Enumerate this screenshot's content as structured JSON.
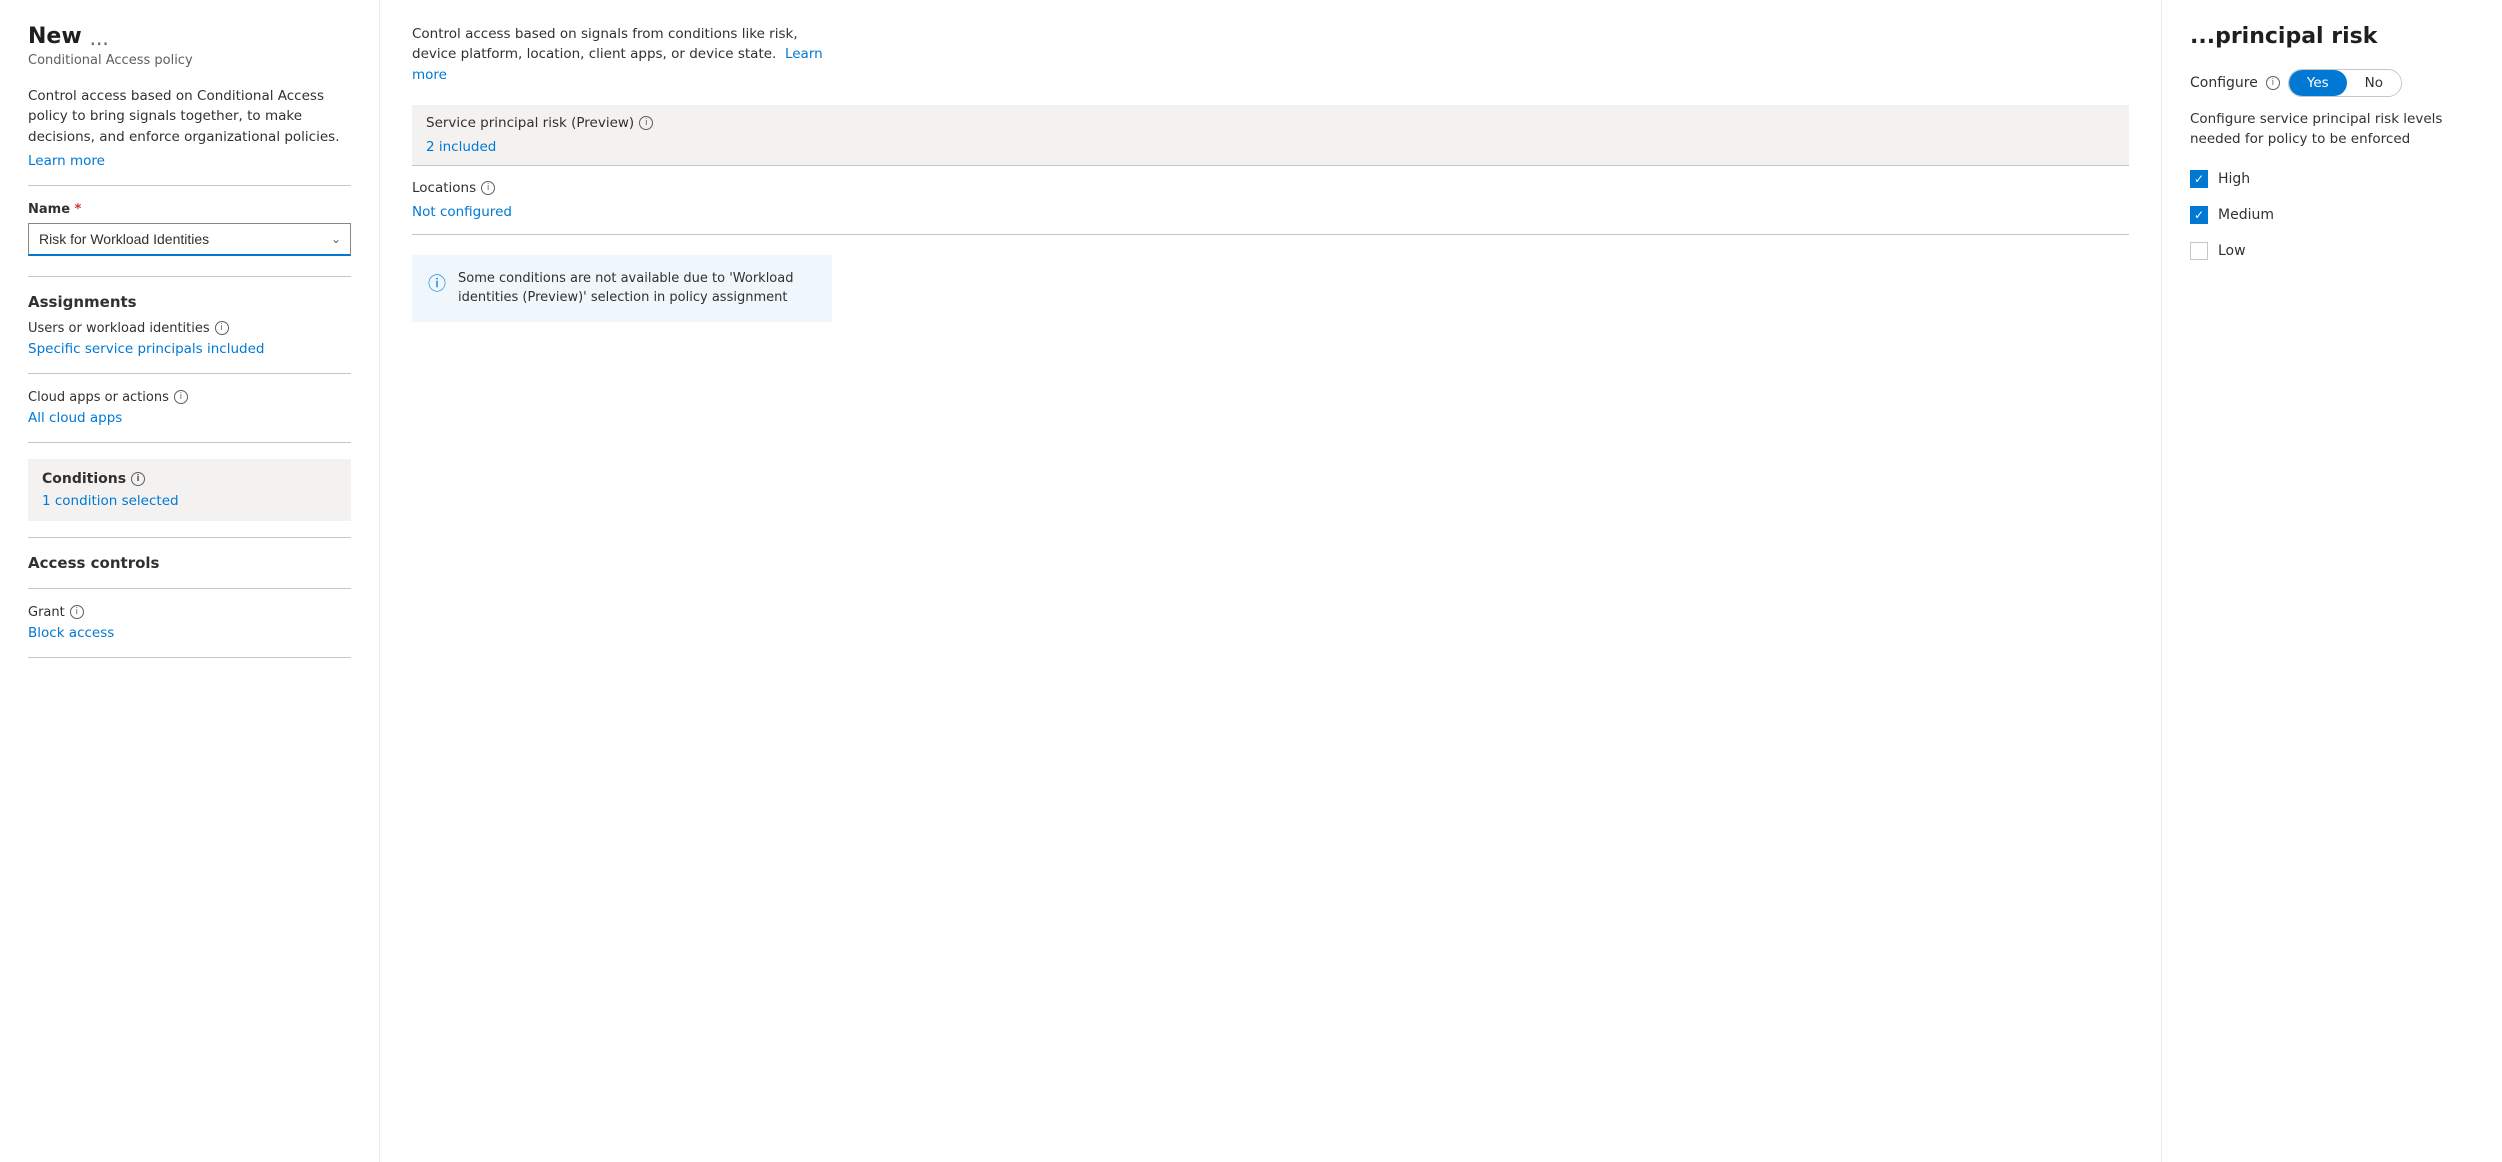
{
  "left": {
    "title": "New",
    "title_ellipsis": "...",
    "subtitle": "Conditional Access policy",
    "description": "Control access based on Conditional Access policy to bring signals together, to make decisions, and enforce organizational policies.",
    "learn_more": "Learn more",
    "name_label": "Name",
    "name_placeholder": "Risk for Workload Identities",
    "assignments_heading": "Assignments",
    "users_label": "Users or workload identities",
    "users_value": "Specific service principals included",
    "cloud_apps_label": "Cloud apps or actions",
    "cloud_apps_value": "All cloud apps",
    "conditions_heading": "Conditions",
    "conditions_value": "1 condition selected",
    "access_controls_heading": "Access controls",
    "grant_label": "Grant",
    "grant_value": "Block access"
  },
  "middle": {
    "description": "Control access based on signals from conditions like risk, device platform, location, client apps, or device state.",
    "learn_more": "Learn more",
    "service_principal_risk_label": "Service principal risk (Preview)",
    "service_principal_risk_value": "2 included",
    "locations_label": "Locations",
    "locations_value": "Not configured",
    "info_banner_text": "Some conditions are not available due to 'Workload identities (Preview)' selection in policy assignment"
  },
  "right": {
    "panel_title": "principal risk",
    "configure_label": "Configure",
    "toggle_yes": "Yes",
    "toggle_no": "No",
    "configure_desc": "Configure service principal risk levels needed for policy to be enforced",
    "checkboxes": [
      {
        "id": "high",
        "label": "High",
        "checked": true
      },
      {
        "id": "medium",
        "label": "Medium",
        "checked": true
      },
      {
        "id": "low",
        "label": "Low",
        "checked": false
      }
    ]
  }
}
